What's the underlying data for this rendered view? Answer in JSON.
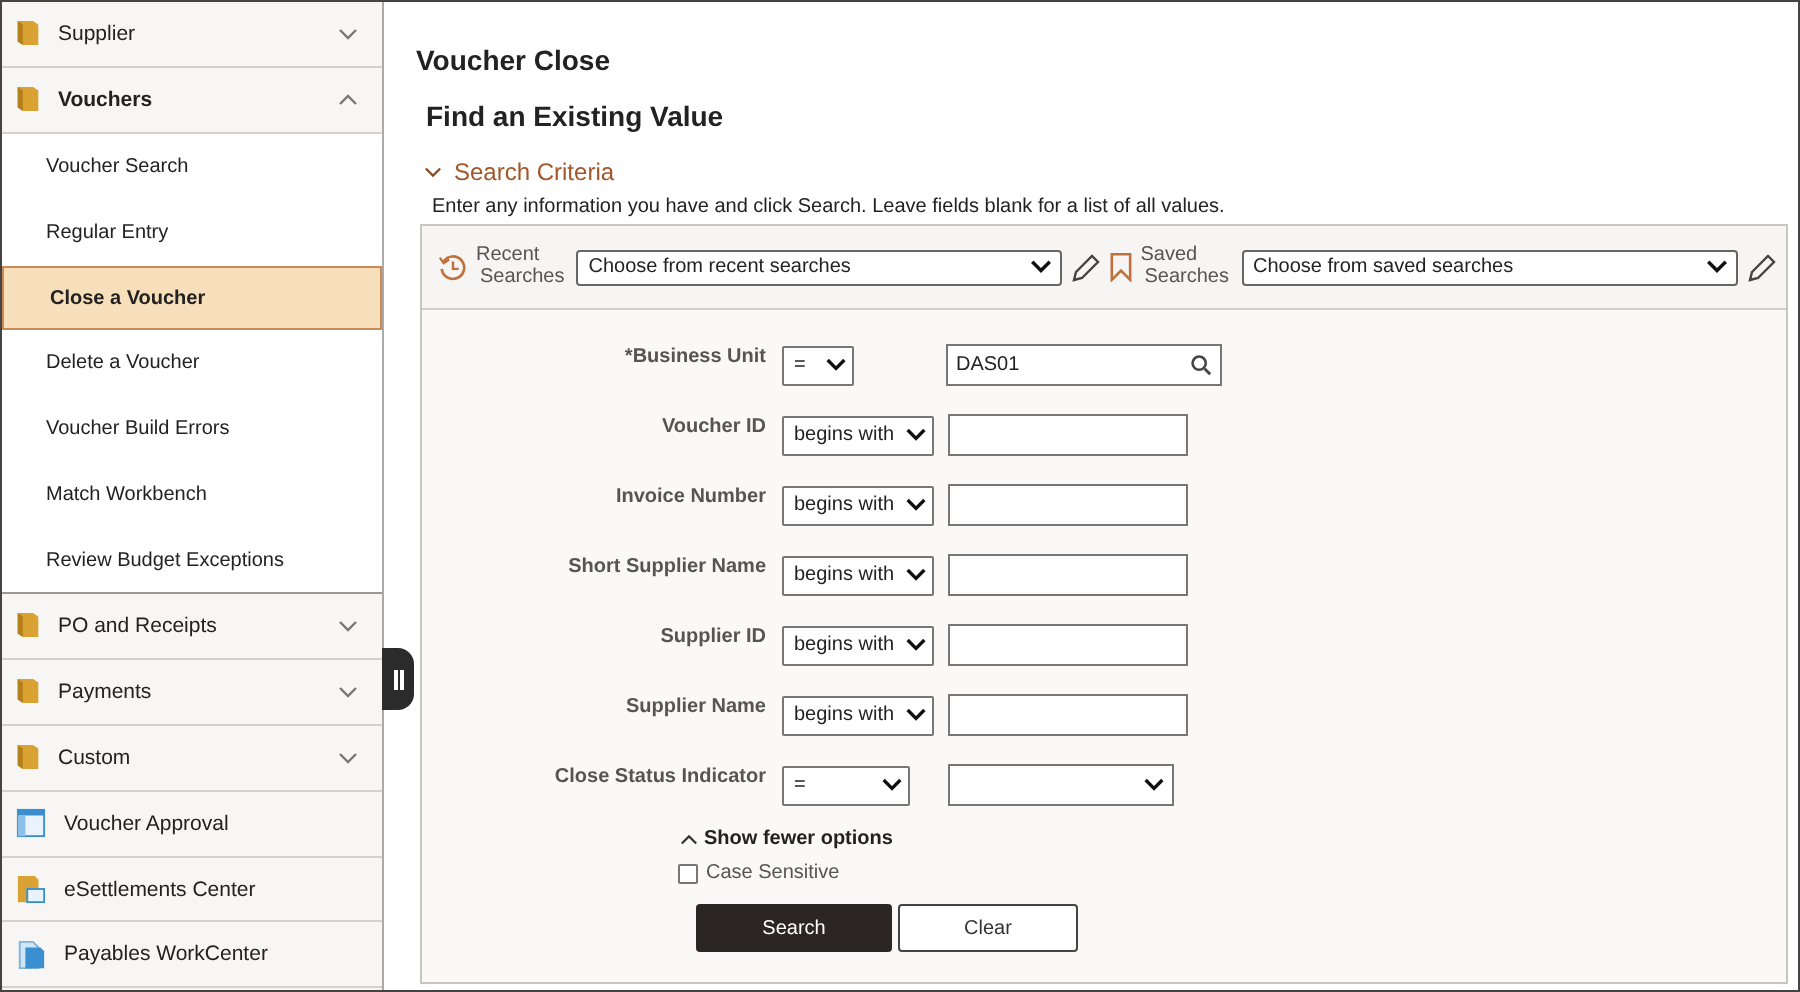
{
  "sidebar": {
    "items": [
      {
        "kind": "folder",
        "label": "Supplier",
        "expanded": false,
        "selected": false
      },
      {
        "kind": "folder",
        "label": "Vouchers",
        "expanded": true,
        "selected": false
      },
      {
        "kind": "page",
        "label": "Voucher Search",
        "selected": false
      },
      {
        "kind": "page",
        "label": "Regular Entry",
        "selected": false
      },
      {
        "kind": "page",
        "label": "Close a Voucher",
        "selected": true
      },
      {
        "kind": "page",
        "label": "Delete a Voucher",
        "selected": false
      },
      {
        "kind": "page",
        "label": "Voucher Build Errors",
        "selected": false
      },
      {
        "kind": "page",
        "label": "Match Workbench",
        "selected": false
      },
      {
        "kind": "page",
        "label": "Review Budget Exceptions",
        "selected": false
      },
      {
        "kind": "folder",
        "label": "PO and Receipts",
        "expanded": false,
        "selected": false
      },
      {
        "kind": "folder",
        "label": "Payments",
        "expanded": false,
        "selected": false
      },
      {
        "kind": "folder",
        "label": "Custom",
        "expanded": false,
        "selected": false
      },
      {
        "kind": "tile",
        "label": "Voucher Approval",
        "selected": false
      },
      {
        "kind": "tile",
        "label": "eSettlements Center",
        "selected": false
      },
      {
        "kind": "tile",
        "label": "Payables WorkCenter",
        "selected": false
      }
    ]
  },
  "page": {
    "title": "Voucher Close",
    "subtitle": "Find an Existing Value"
  },
  "search_criteria": {
    "heading": "Search Criteria",
    "expanded": true,
    "instructions": "Enter any information you have and click Search. Leave fields blank for a list of all values.",
    "recent": {
      "label_1": "Recent",
      "label_2": "Searches",
      "placeholder": "Choose from recent searches"
    },
    "saved": {
      "label_1": "Saved",
      "label_2": "Searches",
      "placeholder": "Choose from saved searches"
    },
    "fields": [
      {
        "kind": "lookup",
        "label": "*Business Unit",
        "operator": "=",
        "value": "DAS01"
      },
      {
        "kind": "text",
        "label": "Voucher ID",
        "operator": "begins with"
      },
      {
        "kind": "text",
        "label": "Invoice Number",
        "operator": "begins with"
      },
      {
        "kind": "text",
        "label": "Short Supplier Name",
        "operator": "begins with"
      },
      {
        "kind": "text",
        "label": "Supplier ID",
        "operator": "begins with"
      },
      {
        "kind": "text",
        "label": "Supplier Name",
        "operator": "begins with"
      },
      {
        "kind": "select",
        "label": "Close Status Indicator",
        "operator": "="
      }
    ],
    "options_toggle": "Show fewer options",
    "case_sensitive": {
      "label": "Case Sensitive",
      "checked": false
    },
    "buttons": [
      "Search",
      "Clear"
    ]
  }
}
